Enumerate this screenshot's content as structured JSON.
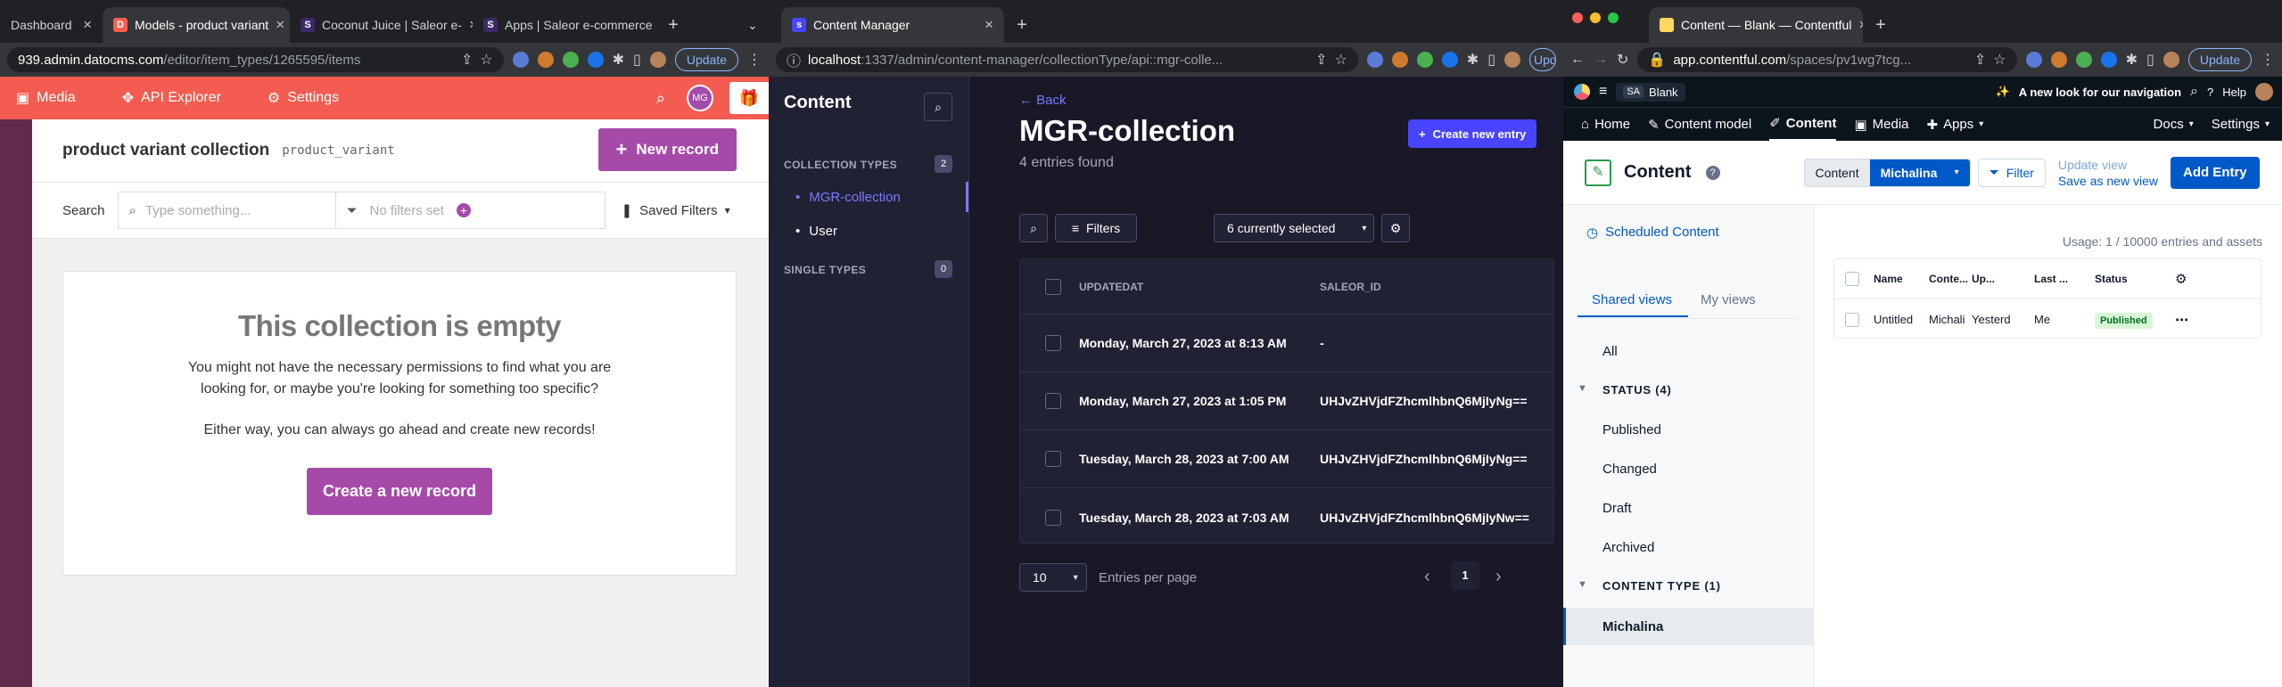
{
  "window1": {
    "tabs": [
      {
        "title": "Dashboard",
        "active": false,
        "favicon": "none"
      },
      {
        "title": "Models - product variant",
        "active": true,
        "favicon": "datocms"
      },
      {
        "title": "Coconut Juice | Saleor e-",
        "active": false,
        "favicon": "saleor"
      },
      {
        "title": "Apps | Saleor e-commerce",
        "active": false,
        "favicon": "saleor"
      }
    ],
    "url_host": "939.admin.datocms.com",
    "url_path": "/editor/item_types/1265595/items",
    "update_label": "Update",
    "nav": {
      "media": "Media",
      "api_explorer": "API Explorer",
      "settings": "Settings",
      "avatar": "MG"
    },
    "title": "product variant collection",
    "api_key": "product_variant",
    "new_record": "New record",
    "search_label": "Search",
    "search_placeholder": "Type something...",
    "filters_placeholder": "No filters set",
    "saved_filters": "Saved Filters",
    "empty_title": "This collection is empty",
    "empty_line1": "You might not have the necessary permissions to find what you are",
    "empty_line2": "looking for, or maybe you're looking for something too specific?",
    "empty_line3": "Either way, you can always go ahead and create new records!",
    "create_button": "Create a new record"
  },
  "window2": {
    "tab_title": "Content Manager",
    "url_host": "localhost",
    "url_path": ":1337/admin/content-manager/collectionType/api::mgr-colle...",
    "update_label": "Update",
    "sidebar_title": "Content",
    "collection_types_label": "COLLECTION TYPES",
    "collection_types_count": "2",
    "collection_items": [
      "MGR-collection",
      "User"
    ],
    "single_types_label": "SINGLE TYPES",
    "single_types_count": "0",
    "back": "Back",
    "title": "MGR-collection",
    "subtitle": "4 entries found",
    "create_entry": "Create new entry",
    "filters": "Filters",
    "selected": "6 currently selected",
    "columns": [
      "UPDATEDAT",
      "SALEOR_ID"
    ],
    "rows": [
      {
        "updated": "Monday, March 27, 2023 at 8:13 AM",
        "saleor_id": "-"
      },
      {
        "updated": "Monday, March 27, 2023 at 1:05 PM",
        "saleor_id": "UHJvZHVjdFZhcmlhbnQ6MjIyNg=="
      },
      {
        "updated": "Tuesday, March 28, 2023 at 7:00 AM",
        "saleor_id": "UHJvZHVjdFZhcmlhbnQ6MjIyNg=="
      },
      {
        "updated": "Tuesday, March 28, 2023 at 7:03 AM",
        "saleor_id": "UHJvZHVjdFZhcmlhbnQ6MjIyNw=="
      }
    ],
    "page_size": "10",
    "entries_per_page": "Entries per page",
    "current_page": "1"
  },
  "window3": {
    "tab_title": "Content — Blank — Contentful",
    "url_host": "app.contentful.com",
    "url_path": "/spaces/pv1wg7tcg...",
    "update_label": "Update",
    "space_initials": "SA",
    "space_name": "Blank",
    "announcement": "A new look for our navigation",
    "help": "Help",
    "nav": [
      "Home",
      "Content model",
      "Content",
      "Media",
      "Apps"
    ],
    "docs": "Docs",
    "settings": "Settings",
    "header_title": "Content",
    "segment_content": "Content",
    "segment_type": "Michalina",
    "filter": "Filter",
    "update_view": "Update view",
    "save_view": "Save as new view",
    "add_entry": "Add Entry",
    "scheduled": "Scheduled Content",
    "shared_views": "Shared views",
    "my_views": "My views",
    "all": "All",
    "status_label": "STATUS (4)",
    "statuses": [
      "Published",
      "Changed",
      "Draft",
      "Archived"
    ],
    "content_type_label": "CONTENT TYPE (1)",
    "content_type_item": "Michalina",
    "usage": "Usage: 1 / 10000 entries and assets",
    "columns": [
      "Name",
      "Conte...",
      "Up...",
      "Last ...",
      "Status"
    ],
    "row": {
      "name": "Untitled",
      "content_type": "Michali",
      "updated": "Yesterd",
      "by": "Me",
      "status": "Published"
    }
  },
  "colors": {
    "dato_red": "#f45c51",
    "dato_purple": "#a64aa9",
    "strapi_primary": "#4945ff",
    "contentful_blue": "#0059c8"
  }
}
